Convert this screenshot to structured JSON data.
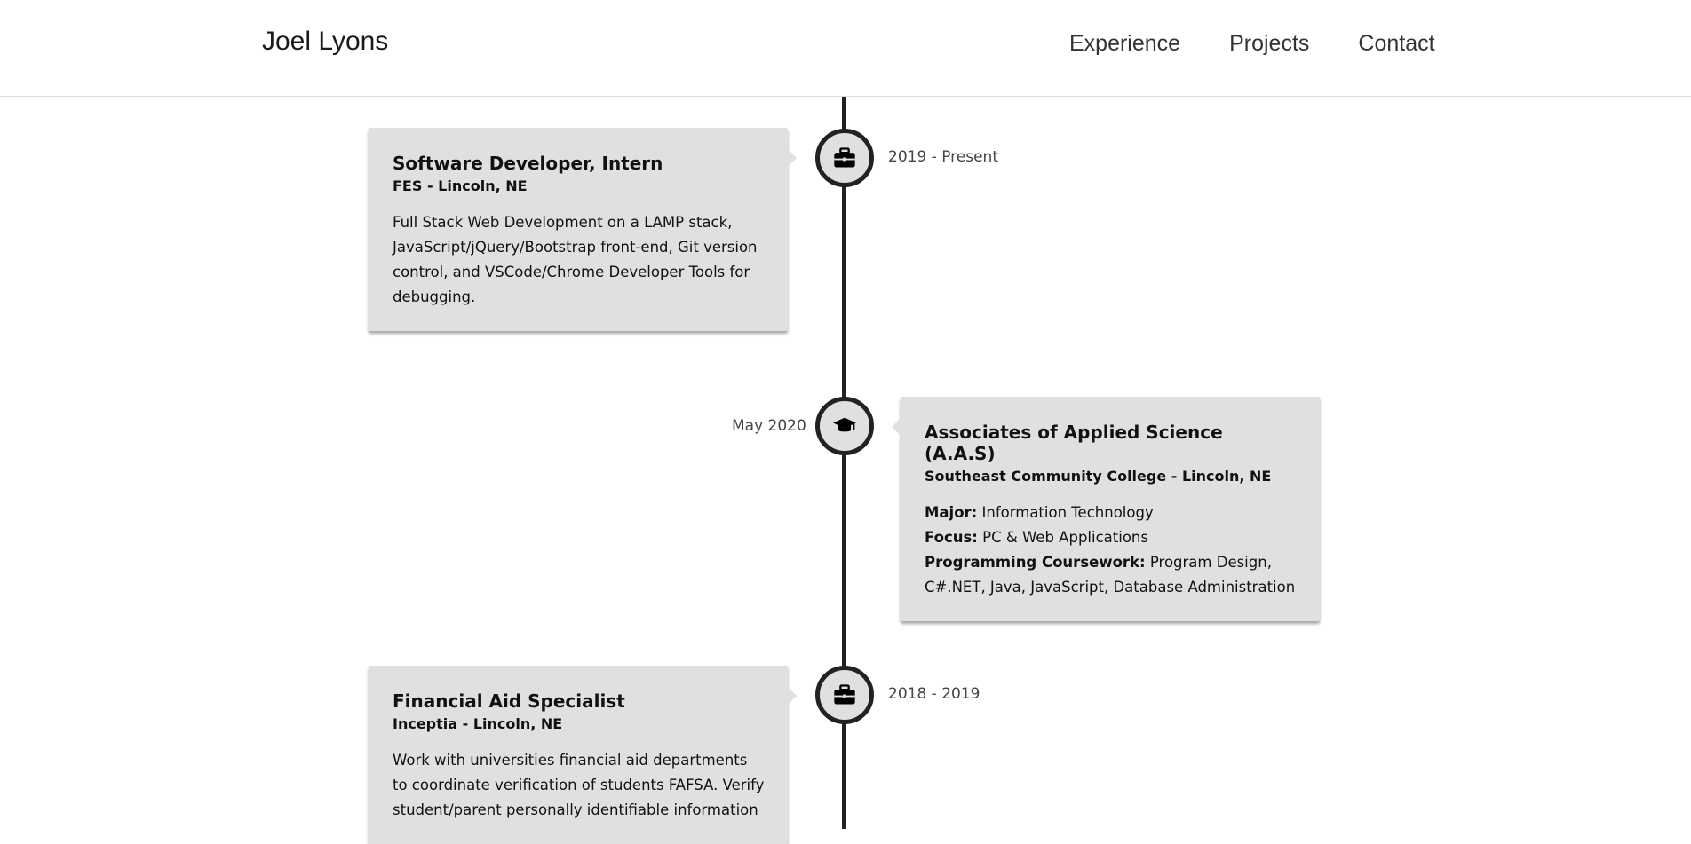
{
  "nav": {
    "brand": "Joel Lyons",
    "links": [
      "Experience",
      "Projects",
      "Contact"
    ]
  },
  "timeline": [
    {
      "type": "work",
      "icon": "briefcase-icon",
      "date": "2019 - Present",
      "title": "Software Developer, Intern",
      "subtitle": "FES - Lincoln, NE",
      "description": "Full Stack Web Development on a LAMP stack, JavaScript/jQuery/Bootstrap front-end, Git version control, and VSCode/Chrome Developer Tools for debugging."
    },
    {
      "type": "education",
      "icon": "graduation-cap-icon",
      "date": "May 2020",
      "title": "Associates of Applied Science (A.A.S)",
      "subtitle": "Southeast Community College - Lincoln, NE",
      "details": [
        {
          "label": "Major:",
          "value": " Information Technology"
        },
        {
          "label": "Focus:",
          "value": " PC & Web Applications"
        },
        {
          "label": "Programming Coursework:",
          "value": " Program Design, C#.NET, Java, JavaScript, Database Administration"
        }
      ]
    },
    {
      "type": "work",
      "icon": "briefcase-icon",
      "date": "2018 - 2019",
      "title": "Financial Aid Specialist",
      "subtitle": "Inceptia - Lincoln, NE",
      "description": "Work with universities financial aid departments to coordinate verification of students FAFSA. Verify student/parent personally identifiable information"
    }
  ],
  "colors": {
    "card_background": "#e0e0e0",
    "timeline_line": "#222222",
    "text": "#111111",
    "date_text": "#444444"
  }
}
